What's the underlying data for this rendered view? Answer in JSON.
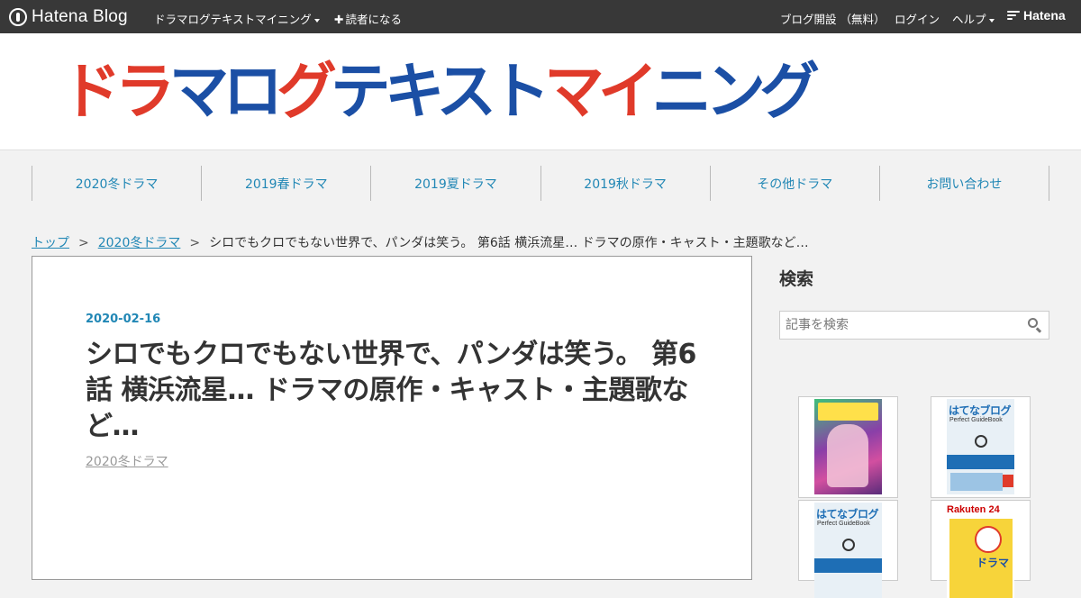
{
  "globalbar": {
    "logo_text": "Hatena Blog",
    "blog_menu": "ドラマログテキストマイニング",
    "subscribe": "読者になる",
    "open_blog": "ブログ開設 （無料）",
    "login": "ログイン",
    "help": "ヘルプ",
    "hatena": "Hatena"
  },
  "header": {
    "title_red_1": "ドラ",
    "title_blue_1": "マロ",
    "title_red_2": "グ",
    "title_blue_2": "テキスト",
    "title_red_3": "マイ",
    "title_blue_3": "ニング"
  },
  "nav": {
    "items": [
      {
        "label": "2020冬ドラマ"
      },
      {
        "label": "2019春ドラマ"
      },
      {
        "label": "2019夏ドラマ"
      },
      {
        "label": "2019秋ドラマ"
      },
      {
        "label": "その他ドラマ"
      },
      {
        "label": "お問い合わせ"
      }
    ]
  },
  "breadcrumb": {
    "top": "トップ",
    "sep": ">",
    "category": "2020冬ドラマ",
    "current": "シロでもクロでもない世界で、パンダは笑う。 第6話 横浜流星… ドラマの原作・キャスト・主題歌など…"
  },
  "article": {
    "date": "2020-02-16",
    "title": "シロでもクロでもない世界で、パンダは笑う。 第6話 横浜流星… ドラマの原作・キャスト・主題歌など…",
    "category": "2020冬ドラマ"
  },
  "sidebar": {
    "search_title": "検索",
    "search_placeholder": "記事を検索",
    "books": {
      "hatena_title": "はてなブログ",
      "hatena_sub": "Perfect GuideBook",
      "rakuten": "Rakuten 24",
      "drama_label": "ドラマ"
    }
  },
  "colors": {
    "accent": "#2187b5",
    "title_red": "#e03a2a",
    "title_blue": "#1b4fa5",
    "globalbar_bg": "#383838"
  }
}
